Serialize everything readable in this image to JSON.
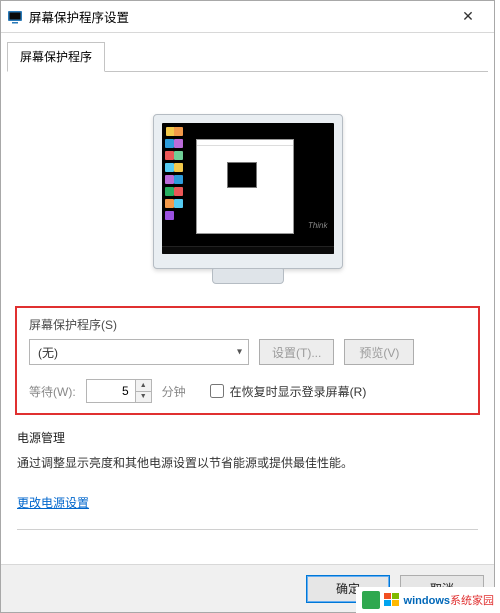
{
  "window": {
    "title": "屏幕保护程序设置",
    "close_glyph": "✕"
  },
  "tabs": {
    "active_label": "屏幕保护程序"
  },
  "preview": {
    "brand_text": "Think"
  },
  "screensaver": {
    "group_label": "屏幕保护程序(S)",
    "selected": "(无)",
    "settings_btn": "设置(T)...",
    "preview_btn": "预览(V)",
    "wait_label": "等待(W):",
    "wait_value": "5",
    "wait_unit": "分钟",
    "resume_checkbox_label": "在恢复时显示登录屏幕(R)"
  },
  "power": {
    "label": "电源管理",
    "text": "通过调整显示亮度和其他电源设置以节省能源或提供最佳性能。",
    "link": "更改电源设置"
  },
  "footer": {
    "ok": "确定",
    "cancel": "取消"
  },
  "watermark": {
    "text_blue": "windows",
    "text_rest": "系统家园"
  }
}
